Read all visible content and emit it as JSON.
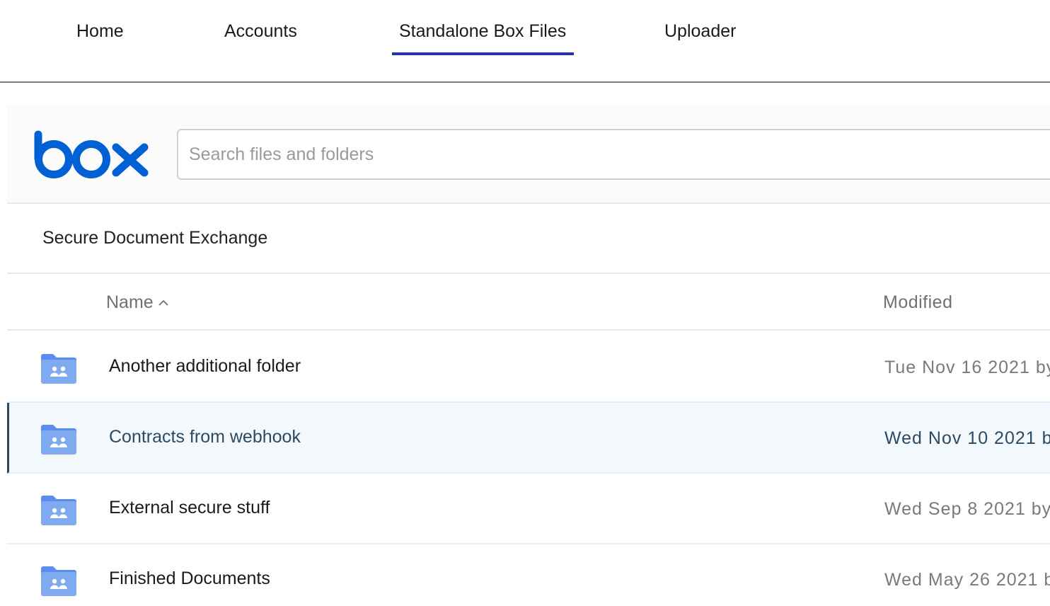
{
  "nav": {
    "tabs": [
      {
        "label": "Home"
      },
      {
        "label": "Accounts"
      },
      {
        "label": "Standalone Box Files",
        "active": true
      },
      {
        "label": "Uploader"
      }
    ]
  },
  "explorer": {
    "logo_text": "box",
    "search": {
      "placeholder": "Search files and folders",
      "value": ""
    },
    "breadcrumb": "Secure Document Exchange",
    "columns": {
      "name": "Name",
      "modified": "Modified",
      "sort": "ascending"
    },
    "items": [
      {
        "name": "Another additional folder",
        "modified": "Tue Nov 16 2021 by",
        "type": "collaborated-folder",
        "selected": false
      },
      {
        "name": "Contracts from webhook",
        "modified": "Wed Nov 10 2021 b",
        "type": "collaborated-folder",
        "selected": true
      },
      {
        "name": "External secure stuff",
        "modified": "Wed Sep 8 2021 by",
        "type": "collaborated-folder",
        "selected": false
      },
      {
        "name": "Finished Documents",
        "modified": "Wed May 26 2021 b",
        "type": "collaborated-folder",
        "selected": false
      }
    ]
  },
  "colors": {
    "accent": "#2436a8",
    "box_blue": "#0061d5",
    "selected_text": "#2d4a62",
    "selected_bg": "#f2f8fc",
    "folder": "#7faaf0"
  }
}
